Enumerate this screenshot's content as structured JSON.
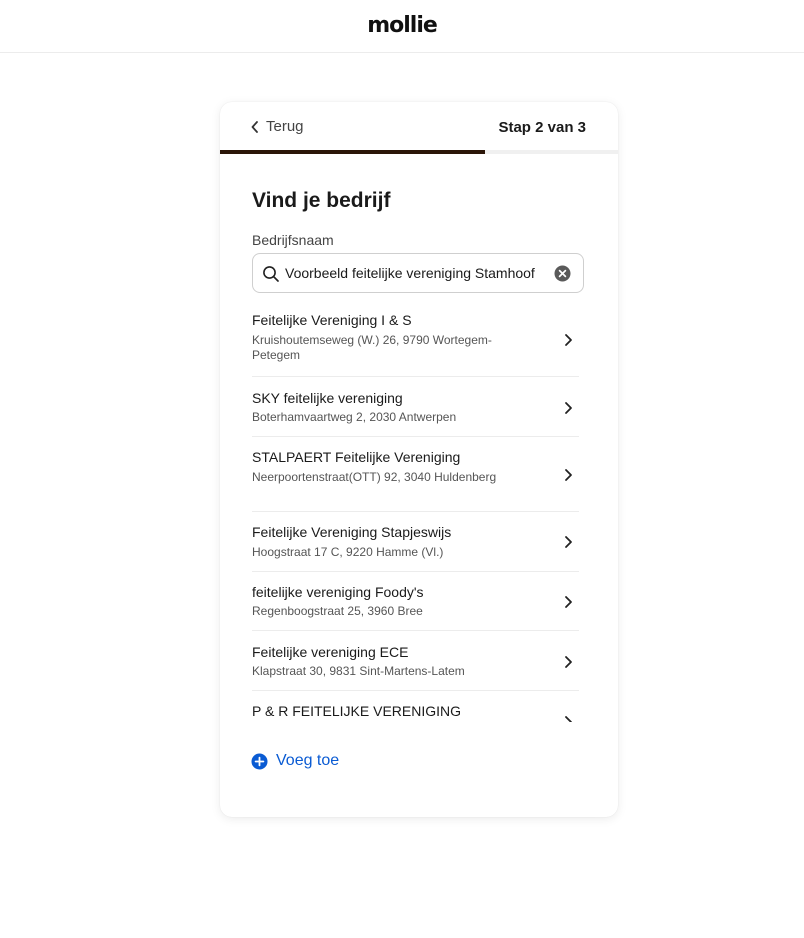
{
  "brand": {
    "logo_text": "mollie"
  },
  "header": {
    "back_label": "Terug",
    "step_label": "Stap 2 van 3",
    "progress_fraction": 0.667,
    "progress_color": "#2b1608"
  },
  "main": {
    "title": "Vind je bedrijf",
    "field_label": "Bedrijfsnaam",
    "search_value": "Voorbeeld feitelijke vereniging Stamhoof"
  },
  "results": [
    {
      "name": "Feitelijke Vereniging I & S",
      "address": "Kruishoutemseweg (W.) 26, 9790 Wortegem-Petegem"
    },
    {
      "name": "SKY feitelijke vereniging",
      "address": "Boterhamvaartweg 2, 2030 Antwerpen"
    },
    {
      "name": "STALPAERT Feitelijke Vereniging",
      "address": "Neerpoortenstraat(OTT) 92, 3040 Huldenberg"
    },
    {
      "name": "Feitelijke Vereniging Stapjeswijs",
      "address": "Hoogstraat 17 C, 9220 Hamme (Vl.)"
    },
    {
      "name": "feitelijke vereniging Foody's",
      "address": "Regenboogstraat 25, 3960 Bree"
    },
    {
      "name": "Feitelijke vereniging ECE",
      "address": "Klapstraat 30, 9831 Sint-Martens-Latem"
    },
    {
      "name": "P & R FEITELIJKE VERENIGING",
      "address": ""
    }
  ],
  "add_button": {
    "label": "Voeg toe",
    "color": "#0a5bd3"
  },
  "icons": {
    "back": "chevron-left-icon",
    "search": "search-icon",
    "clear": "clear-icon",
    "row": "chevron-right-icon",
    "add": "plus-circle-icon"
  }
}
